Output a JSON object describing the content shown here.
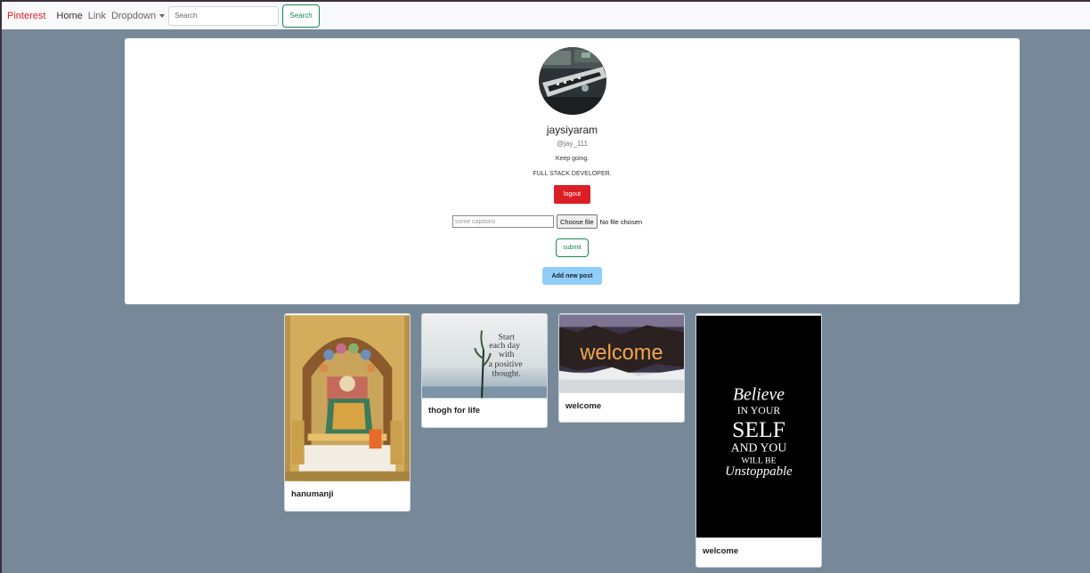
{
  "nav": {
    "brand": "Pinterest",
    "home": "Home",
    "link": "Link",
    "dropdown": "Dropdown",
    "search_placeholder": "Search",
    "search_button": "Search"
  },
  "profile": {
    "username": "jaysiyaram",
    "handle": "@jay_111",
    "bio_line1": "Keep going.",
    "bio_line2": "FULL STACK DEVELOPER.",
    "logout_label": "logout",
    "caption_placeholder": "some captions",
    "choose_file_label": "Choose file",
    "no_file_text": "No file chosen",
    "submit_label": "submit",
    "add_post_label": "Add new post"
  },
  "posts": [
    {
      "title": "hanumanji"
    },
    {
      "title": "thogh for life",
      "image_text": [
        "Start",
        "each day",
        "with",
        "a positive",
        "thought."
      ]
    },
    {
      "title": "welcome",
      "image_text": "welcome"
    },
    {
      "title": "welcome",
      "image_text": [
        "Believe",
        "IN YOUR",
        "SELF",
        "AND YOU",
        "WILL BE",
        "Unstoppable"
      ]
    }
  ],
  "colors": {
    "page_bg": "#778899",
    "brand": "#dc1f26",
    "logout": "#dc1f26",
    "success": "#198754",
    "add_post": "#8fcdfb"
  }
}
